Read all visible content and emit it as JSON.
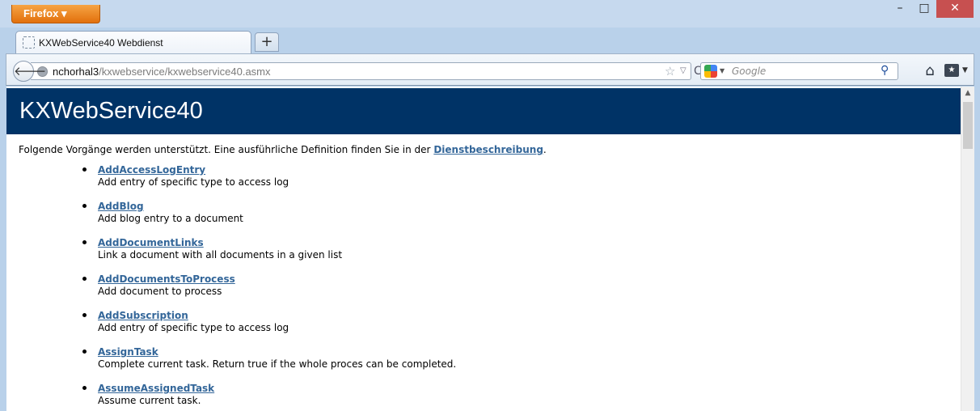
{
  "browser": {
    "app_button_label": "Firefox ▾",
    "window_controls": {
      "minimize": "–",
      "maximize": "□",
      "close": "✕"
    },
    "tab_title": "KXWebService40 Webdienst",
    "new_tab_label": "+",
    "back_glyph": "🡐",
    "url_host": "nchorhal3",
    "url_path": "/kxwebservice/kxwebservice40.asmx",
    "search_placeholder": "Google",
    "icons": [
      "globe-icon",
      "star-icon",
      "dropdown-icon",
      "reload-icon",
      "google-icon",
      "search-icon",
      "home-icon",
      "bookmarks-icon"
    ]
  },
  "page": {
    "title": "KXWebService40",
    "intro_text": "Folgende Vorgänge werden unterstützt. Eine ausführliche Definition finden Sie in der ",
    "intro_link": "Dienstbeschreibung",
    "intro_suffix": ".",
    "operations": [
      {
        "name": "AddAccessLogEntry",
        "description": "Add entry of specific type to access log"
      },
      {
        "name": "AddBlog",
        "description": "Add blog entry to a document"
      },
      {
        "name": "AddDocumentLinks",
        "description": "Link a document with all documents in a given list"
      },
      {
        "name": "AddDocumentsToProcess",
        "description": "Add document to process"
      },
      {
        "name": "AddSubscription",
        "description": "Add entry of specific type to access log"
      },
      {
        "name": "AssignTask",
        "description": "Complete current task. Return true if the whole proces can be completed."
      },
      {
        "name": "AssumeAssignedTask",
        "description": "Assume current task."
      }
    ]
  },
  "colors": {
    "header_band": "#003366",
    "link": "#336699",
    "firefox_button": "#e2700c",
    "close_button": "#c75050"
  }
}
